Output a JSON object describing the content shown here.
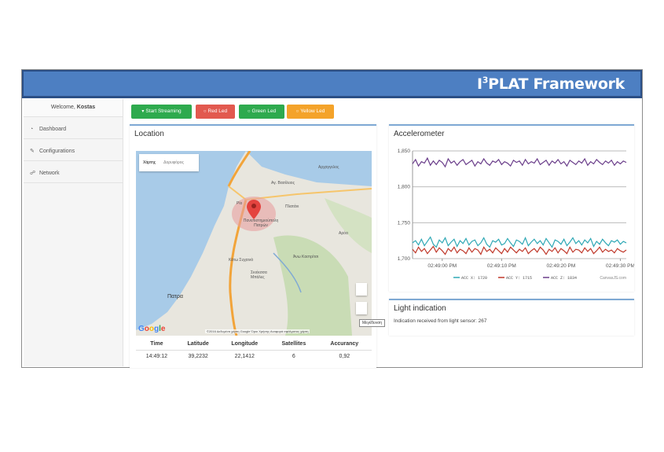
{
  "banner": {
    "title_prefix": "I",
    "title_sup": "3",
    "title_rest": "PLAT Framework"
  },
  "sidebar": {
    "welcome_prefix": "Welcome,",
    "user": "Kostas",
    "items": [
      {
        "label": "Dashboard",
        "icon": "dashboard-icon"
      },
      {
        "label": "Configurations",
        "icon": "wrench-icon"
      },
      {
        "label": "Network",
        "icon": "network-icon"
      }
    ]
  },
  "buttons": [
    {
      "label": "Start Streaming",
      "color": "#2eaa4e",
      "icon": "wifi-icon"
    },
    {
      "label": "Red Led",
      "color": "#e2594f",
      "icon": "circle-icon"
    },
    {
      "label": "Green Led",
      "color": "#2eaa4e",
      "icon": "circle-icon"
    },
    {
      "label": "Yellow Led",
      "color": "#f4a32a",
      "icon": "circle-icon"
    }
  ],
  "location": {
    "title": "Location",
    "map": {
      "tabs": [
        "Χάρτης",
        "Δορυφόρος"
      ],
      "labels": [
        "Αρχαγγελος",
        "Αγ. Βασίλειος",
        "Ρίο",
        "Πλατάνι",
        "Πανεπιστημιούπολη Πατρών",
        "Αρόα",
        "Άνω Καστρίτσι",
        "Κάτω Συχαινά",
        "Σκιόεσσα Μπάλες",
        "Πατρα"
      ],
      "google": "Google",
      "copyright": "©2016 Δεδομένα χάρτη Google  Όροι Χρήσης  Αναφορά σφάλματος χάρτη",
      "tooltip": "Μεγέθυνση"
    },
    "table": {
      "headers": [
        "Time",
        "Latitude",
        "Longitude",
        "Satellites",
        "Accurancy"
      ],
      "rows": [
        [
          "14:49:12",
          "39,2232",
          "22,1412",
          "6",
          "0,92"
        ]
      ]
    }
  },
  "accelerometer": {
    "title": "Accelerometer",
    "credit": "CanvasJS.com",
    "chart_data": {
      "type": "line",
      "ylim": [
        1700,
        1850
      ],
      "yticks": [
        1700,
        1750,
        1800,
        1850
      ],
      "ytick_labels": [
        "1,700",
        "1,750",
        "1,800",
        "1,850"
      ],
      "xtick_labels": [
        "02:49:00 PM",
        "02:49:10 PM",
        "02:49:20 PM",
        "02:49:30 PM"
      ],
      "xlim": [
        0,
        72
      ],
      "xticks": [
        10,
        30,
        50,
        70
      ],
      "legend_position": "bottom",
      "series": [
        {
          "name": "ACC X: 1720",
          "color": "#2fa8b5",
          "values": [
            1722,
            1725,
            1719,
            1727,
            1718,
            1724,
            1730,
            1720,
            1716,
            1726,
            1722,
            1729,
            1718,
            1723,
            1727,
            1717,
            1725,
            1721,
            1728,
            1719,
            1724,
            1726,
            1718,
            1722,
            1729,
            1720,
            1716,
            1725,
            1723,
            1727,
            1719,
            1721,
            1728,
            1722,
            1717,
            1726,
            1724,
            1720,
            1729,
            1718,
            1723,
            1727,
            1721,
            1725,
            1719,
            1728,
            1722,
            1716,
            1726,
            1724,
            1720,
            1727,
            1718,
            1723,
            1729,
            1721,
            1725,
            1719,
            1726,
            1722,
            1728,
            1717,
            1724,
            1720,
            1727,
            1722,
            1718,
            1725,
            1723,
            1726,
            1720,
            1724,
            1722
          ]
        },
        {
          "name": "ACC Y: 1715",
          "color": "#c0392b",
          "values": [
            1713,
            1708,
            1716,
            1710,
            1714,
            1707,
            1712,
            1717,
            1709,
            1715,
            1711,
            1706,
            1714,
            1710,
            1716,
            1708,
            1713,
            1711,
            1707,
            1715,
            1709,
            1714,
            1712,
            1706,
            1716,
            1710,
            1713,
            1708,
            1715,
            1711,
            1707,
            1714,
            1709,
            1716,
            1712,
            1708,
            1713,
            1710,
            1715,
            1707,
            1711,
            1714,
            1709,
            1716,
            1712,
            1706,
            1713,
            1710,
            1715,
            1708,
            1714,
            1711,
            1707,
            1716,
            1709,
            1713,
            1712,
            1708,
            1715,
            1710,
            1714,
            1707,
            1711,
            1716,
            1709,
            1713,
            1710,
            1712,
            1708,
            1714,
            1711,
            1709,
            1712
          ]
        },
        {
          "name": "ACC Z: 1834",
          "color": "#6a3d8a",
          "values": [
            1832,
            1838,
            1829,
            1835,
            1833,
            1840,
            1830,
            1836,
            1831,
            1837,
            1834,
            1828,
            1839,
            1833,
            1836,
            1830,
            1835,
            1838,
            1831,
            1834,
            1837,
            1829,
            1835,
            1832,
            1839,
            1833,
            1830,
            1836,
            1834,
            1838,
            1831,
            1835,
            1833,
            1829,
            1837,
            1834,
            1836,
            1830,
            1838,
            1832,
            1835,
            1833,
            1839,
            1831,
            1834,
            1837,
            1830,
            1836,
            1833,
            1838,
            1832,
            1835,
            1829,
            1837,
            1834,
            1831,
            1836,
            1833,
            1839,
            1830,
            1835,
            1832,
            1838,
            1834,
            1831,
            1836,
            1833,
            1837,
            1830,
            1835,
            1832,
            1836,
            1834
          ]
        }
      ]
    }
  },
  "light": {
    "title": "Light indication",
    "text": "Indication received from light sensor: 267"
  }
}
